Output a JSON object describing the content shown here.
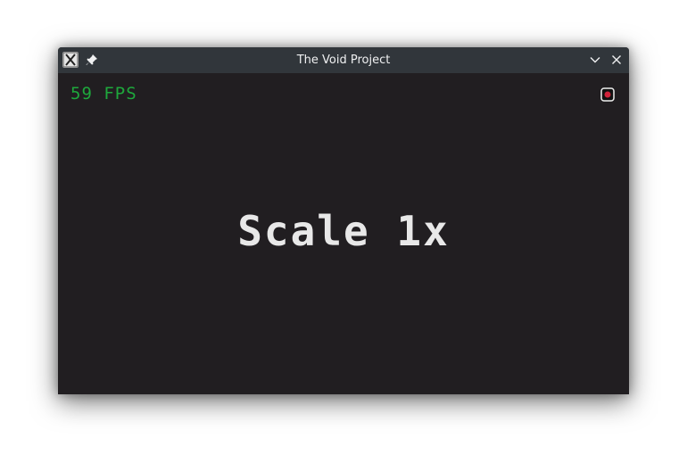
{
  "window": {
    "title": "The Void Project"
  },
  "titlebar": {
    "app_icon": "x-app-icon",
    "pin_icon": "pin-icon",
    "minimize_icon": "chevron-down-icon",
    "close_icon": "close-icon"
  },
  "game": {
    "fps_text": "59 FPS",
    "fps_color": "#1ea83c",
    "scale_text": "Scale 1x",
    "record_icon": "record-icon",
    "background_color": "#211e21"
  }
}
